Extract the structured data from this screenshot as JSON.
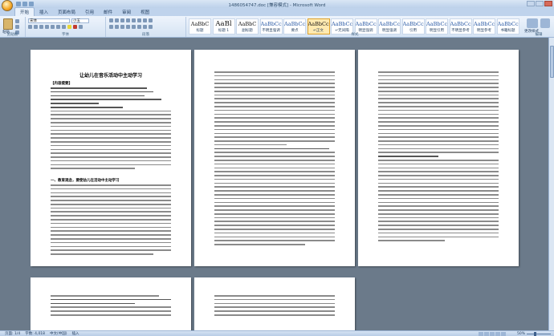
{
  "window": {
    "title": "1486054747.doc [兼容模式] - Microsoft Word"
  },
  "tabs": [
    {
      "label": "开始",
      "active": true
    },
    {
      "label": "插入",
      "active": false
    },
    {
      "label": "页面布局",
      "active": false
    },
    {
      "label": "引用",
      "active": false
    },
    {
      "label": "邮件",
      "active": false
    },
    {
      "label": "审阅",
      "active": false
    },
    {
      "label": "视图",
      "active": false
    }
  ],
  "ribbon": {
    "clipboard": {
      "paste_label": "粘贴",
      "group_label": "剪贴板"
    },
    "font": {
      "font_name": "宋体",
      "font_size": "小五",
      "group_label": "字体"
    },
    "paragraph": {
      "group_label": "段落"
    },
    "styles": {
      "group_label": "样式",
      "items": [
        {
          "sample": "AaBbC",
          "name": "标题"
        },
        {
          "sample": "AaBl",
          "name": "标题 1",
          "big": true
        },
        {
          "sample": "AaBbC",
          "name": "副标题"
        },
        {
          "sample": "AaBbCcDi",
          "name": "不明显强调"
        },
        {
          "sample": "AaBbCcDi",
          "name": "要点"
        },
        {
          "sample": "AaBbCcDd",
          "name": "↵正文",
          "selected": true
        },
        {
          "sample": "AaBbCcDi",
          "name": "↵无间隔"
        },
        {
          "sample": "AaBbCcDi",
          "name": "明显强调"
        },
        {
          "sample": "AaBbCcDi",
          "name": "明显强调"
        },
        {
          "sample": "AaBbCcDi",
          "name": "引用"
        },
        {
          "sample": "AaBbCcDi",
          "name": "明显引用"
        },
        {
          "sample": "AaBbCcDi",
          "name": "不明显参考"
        },
        {
          "sample": "AaBbCcDi",
          "name": "明显参考"
        },
        {
          "sample": "AaBbCcDi",
          "name": "书籍标题"
        }
      ],
      "change_styles_label": "更改样式"
    },
    "editing": {
      "group_label": "编辑"
    }
  },
  "document": {
    "page1_title": "让幼儿在音乐活动中主动学习",
    "page1_heading1": "【内容提要】",
    "page1_heading2": "一、教育观念，要使幼儿在活动中主动学习"
  },
  "statusbar": {
    "page": "页面: 1/4",
    "words": "字数: 4,018",
    "language": "中文(中国)",
    "mode": "插入",
    "zoom": "50%"
  },
  "colors": {
    "ribbon_bg": "#d5e3f3",
    "workspace_bg": "#6b7a8a",
    "selected_style": "#ffeab0"
  }
}
